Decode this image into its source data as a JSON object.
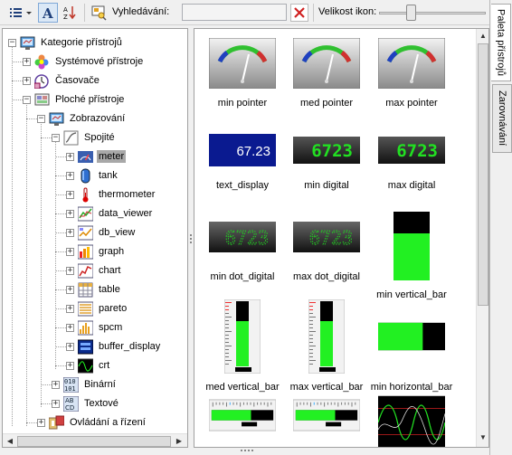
{
  "toolbar": {
    "search_label": "Vyhledávání:",
    "search_value": "",
    "icon_size_label": "Velikost ikon:",
    "icon_size_value": 0.28
  },
  "side_tabs": [
    "Paleta přístrojů",
    "Zarovnávání"
  ],
  "tree": [
    {
      "label": "Kategorie přístrojů",
      "expander": "−",
      "icon": "monitor-icon"
    },
    {
      "label": "Systémové přístroje",
      "expander": "+",
      "icon": "flower-icon"
    },
    {
      "label": "Časovače",
      "expander": "+",
      "icon": "clock-icon"
    },
    {
      "label": "Ploché přístroje",
      "expander": "−",
      "icon": "panel-icon"
    },
    {
      "label": "Zobrazování",
      "expander": "−",
      "icon": "monitor-icon"
    },
    {
      "label": "Spojité",
      "expander": "−",
      "icon": "curve-icon"
    },
    {
      "label": "meter",
      "expander": "+",
      "icon": "meter-icon"
    },
    {
      "label": "tank",
      "expander": "+",
      "icon": "tank-icon"
    },
    {
      "label": "thermometer",
      "expander": "+",
      "icon": "thermometer-icon"
    },
    {
      "label": "data_viewer",
      "expander": "+",
      "icon": "data-viewer-icon"
    },
    {
      "label": "db_view",
      "expander": "+",
      "icon": "db-view-icon"
    },
    {
      "label": "graph",
      "expander": "+",
      "icon": "graph-icon"
    },
    {
      "label": "chart",
      "expander": "+",
      "icon": "chart-icon"
    },
    {
      "label": "table",
      "expander": "+",
      "icon": "table-icon"
    },
    {
      "label": "pareto",
      "expander": "+",
      "icon": "pareto-icon"
    },
    {
      "label": "spcm",
      "expander": "+",
      "icon": "spcm-icon"
    },
    {
      "label": "buffer_display",
      "expander": "+",
      "icon": "buffer-display-icon"
    },
    {
      "label": "crt",
      "expander": "+",
      "icon": "crt-icon"
    },
    {
      "label": "Binární",
      "expander": "+",
      "icon": "binary-icon"
    },
    {
      "label": "Textové",
      "expander": "+",
      "icon": "text-icon"
    },
    {
      "label": "Ovládání a řízení",
      "expander": "+",
      "icon": "controls-icon"
    }
  ],
  "gallery": {
    "items": [
      {
        "label": "min pointer",
        "kind": "gauge"
      },
      {
        "label": "med pointer",
        "kind": "gauge"
      },
      {
        "label": "max pointer",
        "kind": "gauge"
      },
      {
        "label": "text_display",
        "kind": "text-display",
        "display": "67.23"
      },
      {
        "label": "min digital",
        "kind": "digital",
        "display": "6723"
      },
      {
        "label": "max digital",
        "kind": "digital",
        "display": "6723"
      },
      {
        "label": "min dot_digital",
        "kind": "dot-digital",
        "display": "6723"
      },
      {
        "label": "max dot_digital",
        "kind": "dot-digital",
        "display": "6723"
      },
      {
        "label": "min vertical_bar",
        "kind": "vbar"
      },
      {
        "label": "med vertical_bar",
        "kind": "vbar-scale"
      },
      {
        "label": "max vertical_bar",
        "kind": "vbar-scale"
      },
      {
        "label": "min horizontal_bar",
        "kind": "hbar"
      },
      {
        "label": "",
        "kind": "hbar-scale"
      },
      {
        "label": "",
        "kind": "hbar-scale"
      },
      {
        "label": "",
        "kind": "crt"
      }
    ]
  }
}
